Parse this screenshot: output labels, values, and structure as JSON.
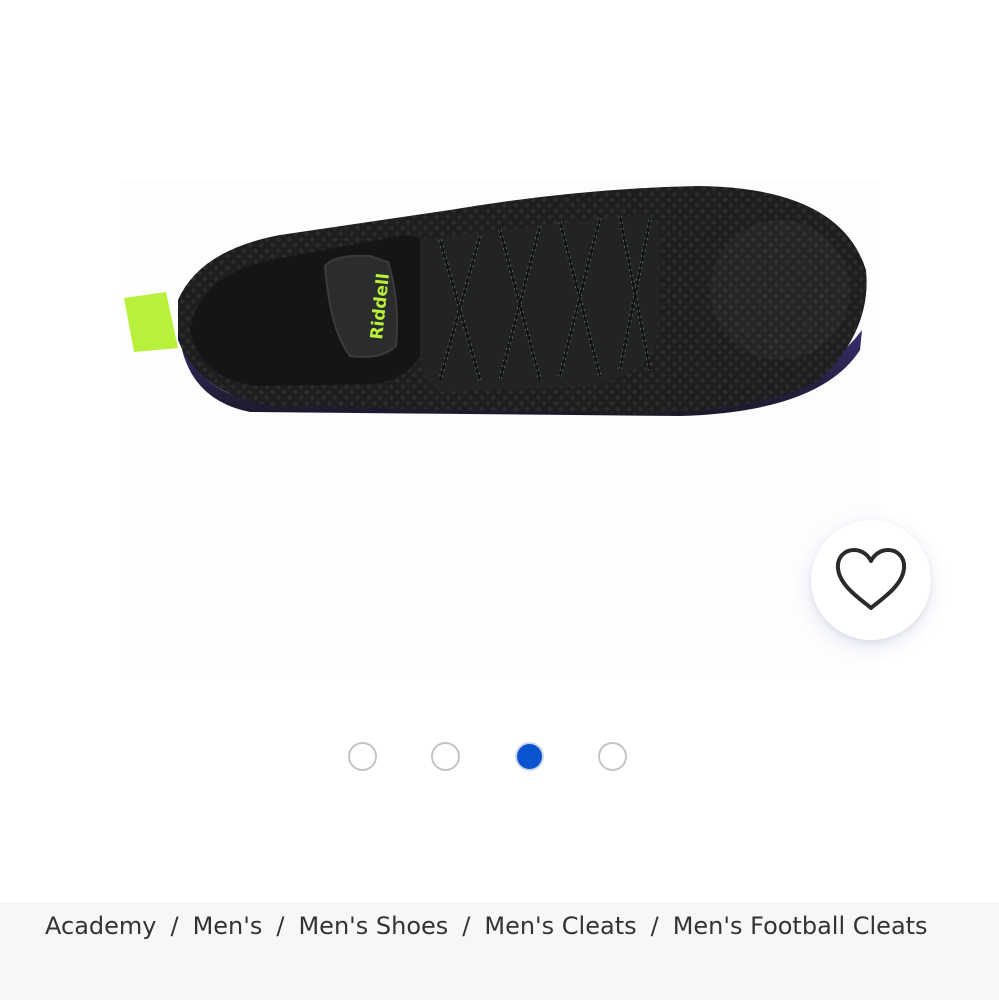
{
  "product": {
    "image_alt": "Riddell black football cleat, top view",
    "brand_text": "Riddell",
    "colors": {
      "shoe": "#1f2021",
      "accent": "#b8f03c",
      "laces": "#2a2b2c"
    }
  },
  "favorite": {
    "icon": "heart-outline-icon"
  },
  "carousel": {
    "count": 4,
    "active_index": 2,
    "active_color": "#0a55cf"
  },
  "breadcrumb": {
    "items": [
      "Academy",
      "Men's",
      "Men's Shoes",
      "Men's Cleats",
      "Men's Football Cleats"
    ],
    "separator": "/"
  }
}
